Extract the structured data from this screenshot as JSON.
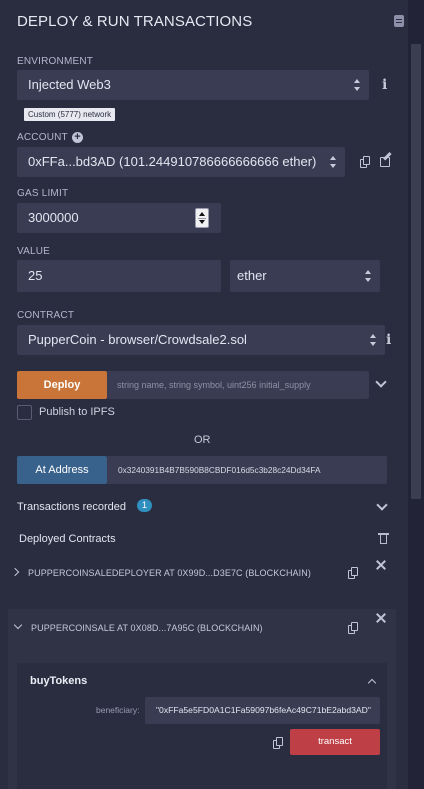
{
  "header": {
    "title": "DEPLOY & RUN TRANSACTIONS",
    "plugin_icon": "plugin-manager-icon"
  },
  "environment": {
    "label": "ENVIRONMENT",
    "value": "Injected Web3",
    "network_badge": "Custom (5777) network",
    "info_icon": "info-icon"
  },
  "account": {
    "label": "ACCOUNT",
    "value": "0xFFa...bd3AD (101.244910786666666666 ether)"
  },
  "gas_limit": {
    "label": "GAS LIMIT",
    "value": "3000000"
  },
  "value": {
    "label": "VALUE",
    "amount": "25",
    "unit": "ether"
  },
  "contract": {
    "label": "CONTRACT",
    "value": "PupperCoin - browser/Crowdsale2.sol"
  },
  "deploy": {
    "button_label": "Deploy",
    "args_placeholder": "string name, string symbol, uint256 initial_supply",
    "publish_label": "Publish to IPFS"
  },
  "or_label": "OR",
  "at_address": {
    "button_label": "At Address",
    "value": "0x3240391B4B7B590B8CBDF016d5c3b28c24Dd34FA"
  },
  "transactions": {
    "label": "Transactions recorded",
    "count": "1"
  },
  "deployed": {
    "label": "Deployed Contracts",
    "contracts": [
      {
        "name": "PUPPERCOINSALEDEPLOYER AT 0X99D...D3E7C (BLOCKCHAIN)"
      },
      {
        "name": "PUPPERCOINSALE AT 0X08D...7A95C (BLOCKCHAIN)"
      }
    ]
  },
  "function": {
    "name": "buyTokens",
    "param_label": "beneficiary:",
    "param_value": "\"0xFFa5e5FD0A1C1Fa59097b6feAc49C71bE2abd3AD\"",
    "transact_label": "transact"
  },
  "colors": {
    "deploy": "#c97539",
    "at_address": "#38628c",
    "transact": "#bf3f46",
    "badge": "#2f8fbf"
  }
}
